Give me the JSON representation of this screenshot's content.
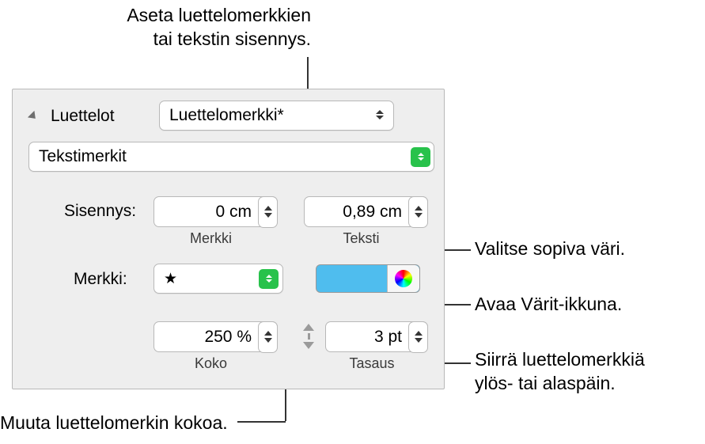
{
  "callouts": {
    "top": "Aseta luettelomerkkien\ntai tekstin sisennys.",
    "right1": "Valitse sopiva väri.",
    "right2": "Avaa Värit-ikkuna.",
    "right3": "Siirrä luettelomerkkiä\nylös- tai alaspäin.",
    "bottom": "Muuta luettelomerkin kokoa."
  },
  "panel": {
    "listsLabel": "Luettelot",
    "styleValue": "Luettelomerkki*",
    "typeValue": "Tekstimerkit",
    "indent": {
      "label": "Sisennys:",
      "bulletLabel": "Merkki",
      "bulletValue": "0 cm",
      "textLabel": "Teksti",
      "textValue": "0,89 cm"
    },
    "character": {
      "label": "Merkki:",
      "glyph": "★"
    },
    "size": {
      "label": "Koko",
      "value": "250 %"
    },
    "align": {
      "label": "Tasaus",
      "value": "3 pt"
    }
  }
}
